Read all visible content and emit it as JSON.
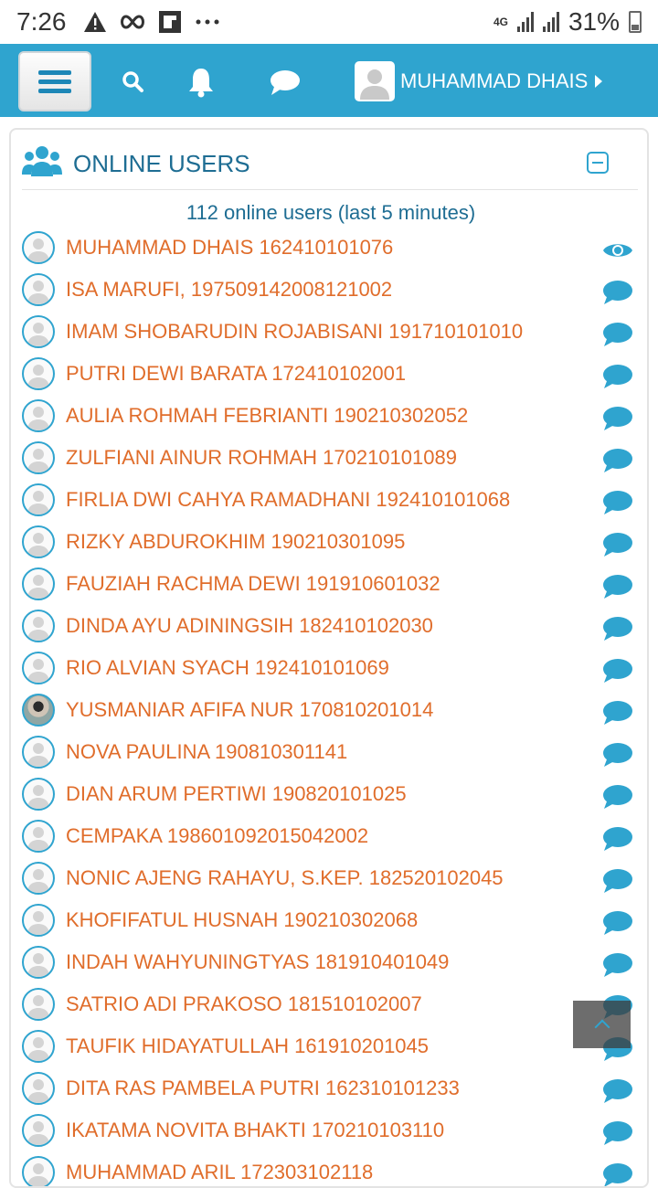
{
  "status_bar": {
    "time": "7:26",
    "network": "4G",
    "battery": "31%"
  },
  "navbar": {
    "user_name": "MUHAMMAD DHAIS",
    "color": "#2fa4cf"
  },
  "block": {
    "title": "ONLINE USERS",
    "summary": "112 online users (last 5 minutes)"
  },
  "users": [
    {
      "name": "MUHAMMAD DHAIS 162410101076",
      "action": "eye-icon"
    },
    {
      "name": "ISA MARUFI, 197509142008121002",
      "action": "message-icon"
    },
    {
      "name": "IMAM SHOBARUDIN ROJABISANI 191710101010",
      "action": "message-icon"
    },
    {
      "name": "PUTRI DEWI BARATA 172410102001",
      "action": "message-icon"
    },
    {
      "name": "AULIA ROHMAH FEBRIANTI 190210302052",
      "action": "message-icon"
    },
    {
      "name": "ZULFIANI AINUR ROHMAH 170210101089",
      "action": "message-icon"
    },
    {
      "name": "FIRLIA DWI CAHYA RAMADHANI 192410101068",
      "action": "message-icon"
    },
    {
      "name": "RIZKY ABDUROKHIM 190210301095",
      "action": "message-icon"
    },
    {
      "name": "FAUZIAH RACHMA DEWI 191910601032",
      "action": "message-icon"
    },
    {
      "name": "DINDA AYU ADININGSIH 182410102030",
      "action": "message-icon"
    },
    {
      "name": "RIO ALVIAN SYACH 192410101069",
      "action": "message-icon"
    },
    {
      "name": "YUSMANIAR AFIFA NUR 170810201014",
      "action": "message-icon",
      "photo": true
    },
    {
      "name": "NOVA PAULINA 190810301141",
      "action": "message-icon"
    },
    {
      "name": "DIAN ARUM PERTIWI 190820101025",
      "action": "message-icon"
    },
    {
      "name": "CEMPAKA 198601092015042002",
      "action": "message-icon"
    },
    {
      "name": "NONIC AJENG RAHAYU, S.KEP. 182520102045",
      "action": "message-icon"
    },
    {
      "name": "KHOFIFATUL HUSNAH 190210302068",
      "action": "message-icon"
    },
    {
      "name": "INDAH WAHYUNINGTYAS 181910401049",
      "action": "message-icon"
    },
    {
      "name": "SATRIO ADI PRAKOSO 181510102007",
      "action": "message-icon"
    },
    {
      "name": "TAUFIK HIDAYATULLAH 161910201045",
      "action": "message-icon"
    },
    {
      "name": "DITA RAS PAMBELA PUTRI 162310101233",
      "action": "message-icon"
    },
    {
      "name": "IKATAMA NOVITA BHAKTI 170210103110",
      "action": "message-icon"
    },
    {
      "name": "MUHAMMAD ARIL 172303102118",
      "action": "message-icon"
    }
  ]
}
